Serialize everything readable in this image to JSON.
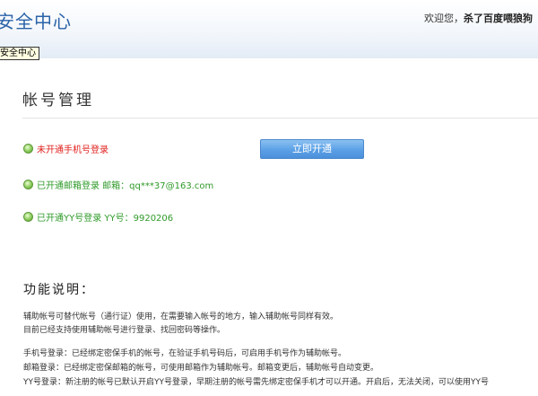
{
  "header": {
    "site_title": "安全中心",
    "welcome_prefix": "欢迎您，",
    "welcome_user": "杀了百度喂狼狗"
  },
  "tooltip": {
    "text": "安全中心"
  },
  "page": {
    "title": "帐号管理"
  },
  "accounts": {
    "phone": {
      "status_text": "未开通手机号登录",
      "button_label": "立即开通",
      "status_color": "#e0201d"
    },
    "email": {
      "status_text": "已开通邮箱登录 邮箱：qq***37@163.com",
      "status_color": "#2f9a29"
    },
    "yy": {
      "status_text": "已开通YY号登录 YY号：9920206",
      "status_color": "#2f9a29"
    }
  },
  "features": {
    "title": "功能说明：",
    "line1": "辅助帐号可替代帐号（通行证）使用，在需要输入帐号的地方，输入辅助帐号同样有效。",
    "line2": "目前已经支持使用辅助帐号进行登录、找回密码等操作。",
    "line3": "手机号登录：已经绑定密保手机的帐号，在验证手机号码后，可启用手机号作为辅助帐号。",
    "line4": "邮箱登录：已经绑定密保邮箱的帐号，可使用邮箱作为辅助帐号。邮箱变更后，辅助帐号自动变更。",
    "line5": "YY号登录：新注册的帐号已默认开启YY号登录，早期注册的帐号需先绑定密保手机才可以开通。开启后，无法关闭，可以使用YY号"
  },
  "colors": {
    "title_blue": "#2a63a8",
    "button_blue": "#5ba0e6",
    "status_red": "#e0201d",
    "status_green": "#2f9a29"
  }
}
